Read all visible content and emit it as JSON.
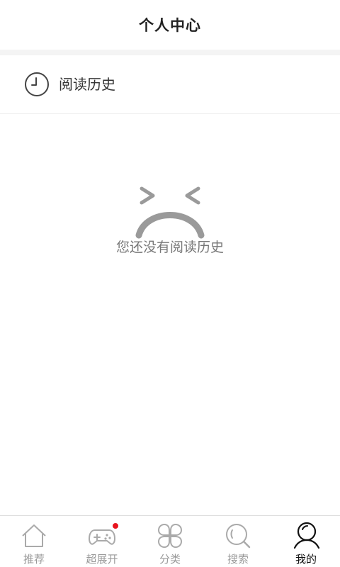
{
  "header": {
    "title": "个人中心"
  },
  "history": {
    "label": "阅读历史",
    "icon": "clock-icon"
  },
  "empty_state": {
    "icon": "sad-face-icon",
    "message": "您还没有阅读历史"
  },
  "tabbar": {
    "tabs": [
      {
        "label": "推荐",
        "icon": "home-icon",
        "active": false
      },
      {
        "label": "超展开",
        "icon": "gamepad-icon",
        "active": false,
        "badge": true
      },
      {
        "label": "分类",
        "icon": "category-icon",
        "active": false
      },
      {
        "label": "搜索",
        "icon": "search-icon",
        "active": false
      },
      {
        "label": "我的",
        "icon": "user-icon",
        "active": true
      }
    ]
  },
  "colors": {
    "inactive": "#999999",
    "active": "#111111",
    "badge": "#e8141e",
    "empty_icon": "#9a9a9a"
  }
}
